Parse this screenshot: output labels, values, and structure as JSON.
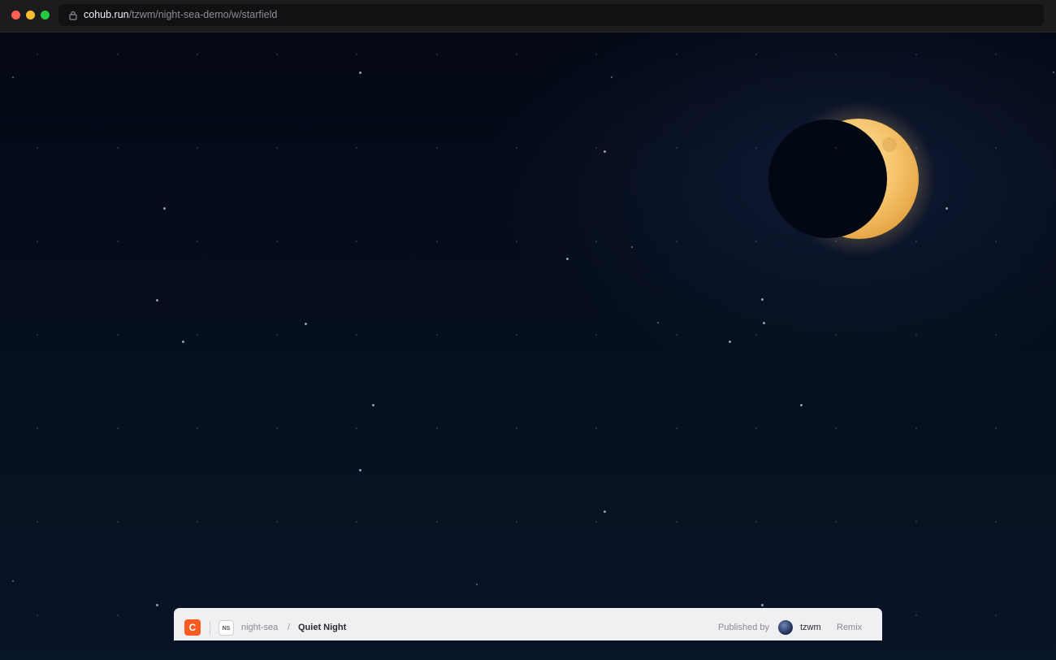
{
  "browser": {
    "url_host": "cohub.run",
    "url_path": "/tzwm/night-sea-demo/w/starfield"
  },
  "scene": {
    "moon_color": "#f6c56d",
    "shadow_color": "#020714",
    "sky_color": "#060b18"
  },
  "toolbar": {
    "app_logo": "C",
    "workspace_badge": "NS",
    "workspace_name": "night-sea",
    "separator": "/",
    "page_title": "Quiet Night",
    "published_label": "Published by",
    "author": "tzwm",
    "remix_label": "Remix"
  }
}
